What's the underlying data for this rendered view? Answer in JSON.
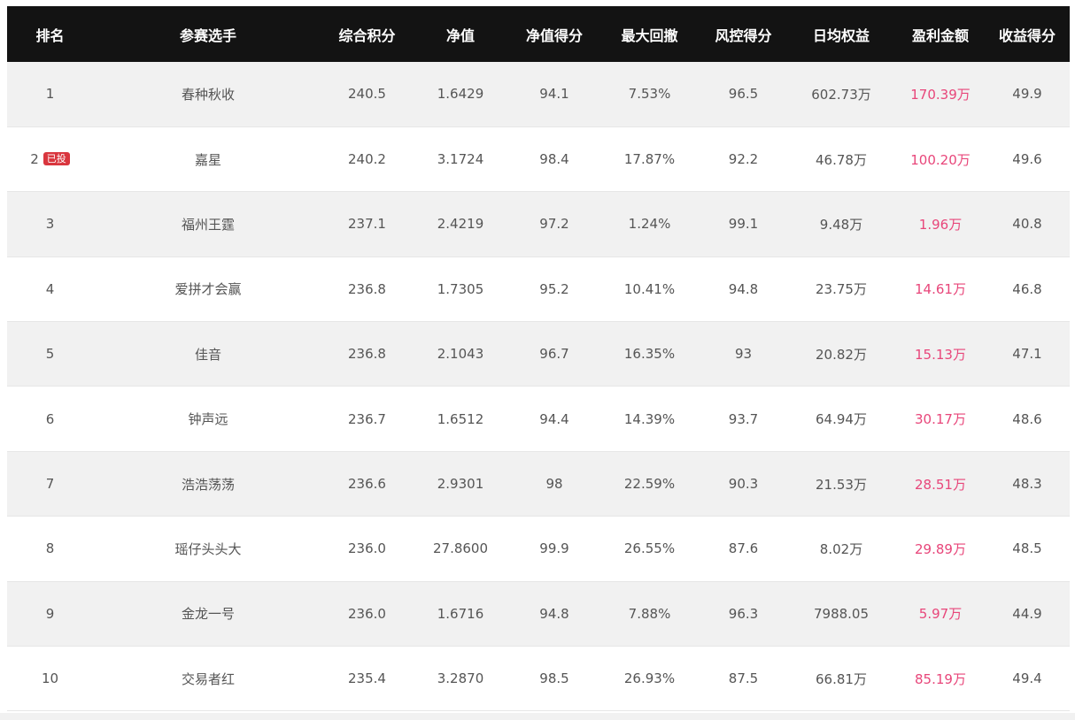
{
  "headers": [
    "排名",
    "参赛选手",
    "综合积分",
    "净值",
    "净值得分",
    "最大回撤",
    "风控得分",
    "日均权益",
    "盈利金额",
    "收益得分"
  ],
  "rows": [
    {
      "rank": "1",
      "badge": "",
      "name": "春种秋收",
      "score": "240.5",
      "nav": "1.6429",
      "nav_score": "94.1",
      "drawdown": "7.53%",
      "risk_score": "96.5",
      "equity": "602.73万",
      "profit": "170.39万",
      "return_score": "49.9"
    },
    {
      "rank": "2",
      "badge": "已投",
      "name": "嘉星",
      "score": "240.2",
      "nav": "3.1724",
      "nav_score": "98.4",
      "drawdown": "17.87%",
      "risk_score": "92.2",
      "equity": "46.78万",
      "profit": "100.20万",
      "return_score": "49.6"
    },
    {
      "rank": "3",
      "badge": "",
      "name": "福州王霆",
      "score": "237.1",
      "nav": "2.4219",
      "nav_score": "97.2",
      "drawdown": "1.24%",
      "risk_score": "99.1",
      "equity": "9.48万",
      "profit": "1.96万",
      "return_score": "40.8"
    },
    {
      "rank": "4",
      "badge": "",
      "name": "爱拼才会赢",
      "score": "236.8",
      "nav": "1.7305",
      "nav_score": "95.2",
      "drawdown": "10.41%",
      "risk_score": "94.8",
      "equity": "23.75万",
      "profit": "14.61万",
      "return_score": "46.8"
    },
    {
      "rank": "5",
      "badge": "",
      "name": "佳音",
      "score": "236.8",
      "nav": "2.1043",
      "nav_score": "96.7",
      "drawdown": "16.35%",
      "risk_score": "93",
      "equity": "20.82万",
      "profit": "15.13万",
      "return_score": "47.1"
    },
    {
      "rank": "6",
      "badge": "",
      "name": "钟声远",
      "score": "236.7",
      "nav": "1.6512",
      "nav_score": "94.4",
      "drawdown": "14.39%",
      "risk_score": "93.7",
      "equity": "64.94万",
      "profit": "30.17万",
      "return_score": "48.6"
    },
    {
      "rank": "7",
      "badge": "",
      "name": "浩浩荡荡",
      "score": "236.6",
      "nav": "2.9301",
      "nav_score": "98",
      "drawdown": "22.59%",
      "risk_score": "90.3",
      "equity": "21.53万",
      "profit": "28.51万",
      "return_score": "48.3"
    },
    {
      "rank": "8",
      "badge": "",
      "name": "瑶仔头头大",
      "score": "236.0",
      "nav": "27.8600",
      "nav_score": "99.9",
      "drawdown": "26.55%",
      "risk_score": "87.6",
      "equity": "8.02万",
      "profit": "29.89万",
      "return_score": "48.5"
    },
    {
      "rank": "9",
      "badge": "",
      "name": "金龙一号",
      "score": "236.0",
      "nav": "1.6716",
      "nav_score": "94.8",
      "drawdown": "7.88%",
      "risk_score": "96.3",
      "equity": "7988.05",
      "profit": "5.97万",
      "return_score": "44.9"
    },
    {
      "rank": "10",
      "badge": "",
      "name": "交易者红",
      "score": "235.4",
      "nav": "3.2870",
      "nav_score": "98.5",
      "drawdown": "26.93%",
      "risk_score": "87.5",
      "equity": "66.81万",
      "profit": "85.19万",
      "return_score": "49.4"
    }
  ],
  "colors": {
    "header_bg": "#131313",
    "row_odd": "#f1f1f1",
    "row_even": "#ffffff",
    "profit": "#e8467a",
    "badge": "#d9363e",
    "text": "#555555"
  }
}
